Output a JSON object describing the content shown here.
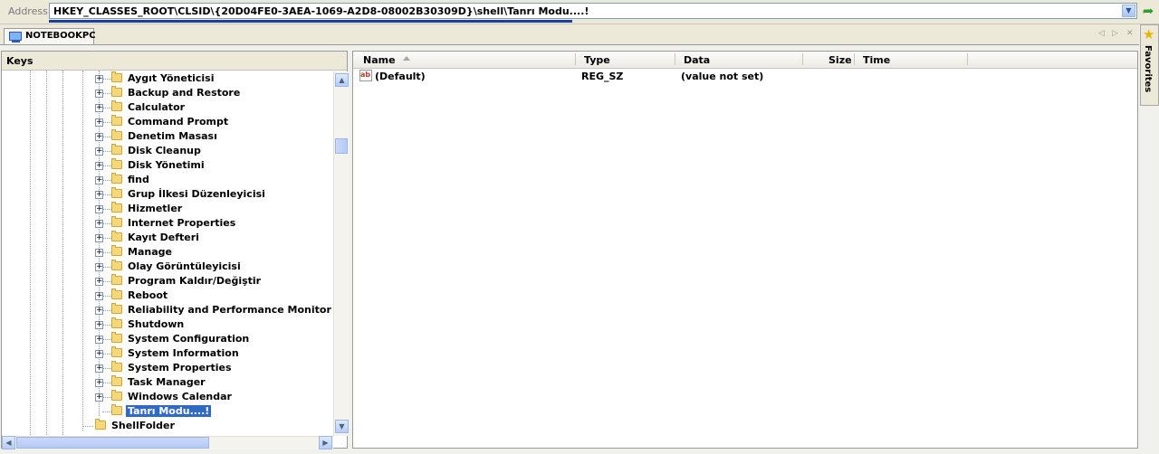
{
  "address": {
    "label": "Address",
    "path": "HKEY_CLASSES_ROOT\\CLSID\\{20D04FE0-3AEA-1069-A2D8-08002B30309D}\\shell\\Tanrı Modu....!"
  },
  "tab": {
    "label": "NOTEBOOKPC"
  },
  "favorites": {
    "label": "Favorites"
  },
  "keys_pane": {
    "title": "Keys",
    "items": [
      "Aygıt Yöneticisi",
      "Backup and Restore",
      "Calculator",
      "Command Prompt",
      "Denetim Masası",
      "Disk Cleanup",
      "Disk Yönetimi",
      "find",
      "Grup İlkesi Düzenleyicisi",
      "Hizmetler",
      "Internet Properties",
      "Kayıt Defteri",
      "Manage",
      "Olay Görüntüleyicisi",
      "Program Kaldır/Değiştir",
      "Reboot",
      "Reliability and Performance Monitor",
      "Shutdown",
      "System Configuration",
      "System Information",
      "System Properties",
      "Task Manager",
      "Windows Calendar"
    ],
    "selected_item": "Tanrı Modu....!",
    "sibling_item": "ShellFolder"
  },
  "values_pane": {
    "columns": {
      "name": "Name",
      "type": "Type",
      "data": "Data",
      "size": "Size",
      "time": "Time"
    },
    "rows": [
      {
        "name": "(Default)",
        "type": "REG_SZ",
        "data": "(value not set)",
        "icon": "string-value-icon"
      }
    ]
  }
}
